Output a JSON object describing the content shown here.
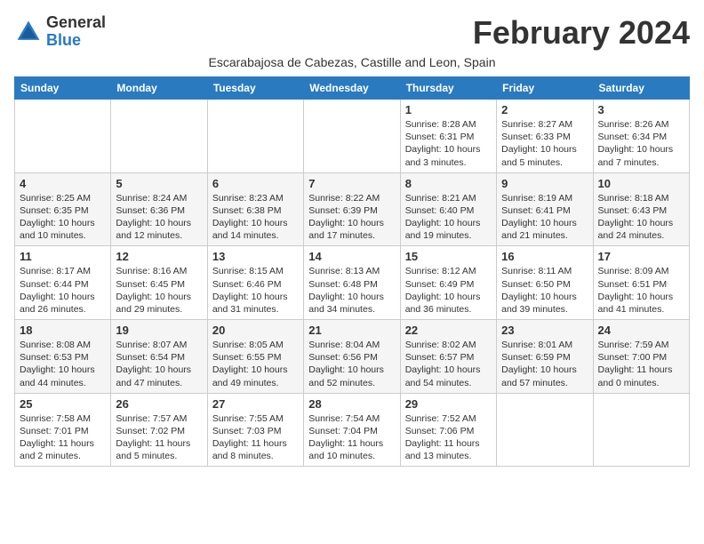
{
  "logo": {
    "general": "General",
    "blue": "Blue"
  },
  "title": "February 2024",
  "subtitle": "Escarabajosa de Cabezas, Castille and Leon, Spain",
  "days_of_week": [
    "Sunday",
    "Monday",
    "Tuesday",
    "Wednesday",
    "Thursday",
    "Friday",
    "Saturday"
  ],
  "weeks": [
    [
      {
        "day": "",
        "info": ""
      },
      {
        "day": "",
        "info": ""
      },
      {
        "day": "",
        "info": ""
      },
      {
        "day": "",
        "info": ""
      },
      {
        "day": "1",
        "info": "Sunrise: 8:28 AM\nSunset: 6:31 PM\nDaylight: 10 hours\nand 3 minutes."
      },
      {
        "day": "2",
        "info": "Sunrise: 8:27 AM\nSunset: 6:33 PM\nDaylight: 10 hours\nand 5 minutes."
      },
      {
        "day": "3",
        "info": "Sunrise: 8:26 AM\nSunset: 6:34 PM\nDaylight: 10 hours\nand 7 minutes."
      }
    ],
    [
      {
        "day": "4",
        "info": "Sunrise: 8:25 AM\nSunset: 6:35 PM\nDaylight: 10 hours\nand 10 minutes."
      },
      {
        "day": "5",
        "info": "Sunrise: 8:24 AM\nSunset: 6:36 PM\nDaylight: 10 hours\nand 12 minutes."
      },
      {
        "day": "6",
        "info": "Sunrise: 8:23 AM\nSunset: 6:38 PM\nDaylight: 10 hours\nand 14 minutes."
      },
      {
        "day": "7",
        "info": "Sunrise: 8:22 AM\nSunset: 6:39 PM\nDaylight: 10 hours\nand 17 minutes."
      },
      {
        "day": "8",
        "info": "Sunrise: 8:21 AM\nSunset: 6:40 PM\nDaylight: 10 hours\nand 19 minutes."
      },
      {
        "day": "9",
        "info": "Sunrise: 8:19 AM\nSunset: 6:41 PM\nDaylight: 10 hours\nand 21 minutes."
      },
      {
        "day": "10",
        "info": "Sunrise: 8:18 AM\nSunset: 6:43 PM\nDaylight: 10 hours\nand 24 minutes."
      }
    ],
    [
      {
        "day": "11",
        "info": "Sunrise: 8:17 AM\nSunset: 6:44 PM\nDaylight: 10 hours\nand 26 minutes."
      },
      {
        "day": "12",
        "info": "Sunrise: 8:16 AM\nSunset: 6:45 PM\nDaylight: 10 hours\nand 29 minutes."
      },
      {
        "day": "13",
        "info": "Sunrise: 8:15 AM\nSunset: 6:46 PM\nDaylight: 10 hours\nand 31 minutes."
      },
      {
        "day": "14",
        "info": "Sunrise: 8:13 AM\nSunset: 6:48 PM\nDaylight: 10 hours\nand 34 minutes."
      },
      {
        "day": "15",
        "info": "Sunrise: 8:12 AM\nSunset: 6:49 PM\nDaylight: 10 hours\nand 36 minutes."
      },
      {
        "day": "16",
        "info": "Sunrise: 8:11 AM\nSunset: 6:50 PM\nDaylight: 10 hours\nand 39 minutes."
      },
      {
        "day": "17",
        "info": "Sunrise: 8:09 AM\nSunset: 6:51 PM\nDaylight: 10 hours\nand 41 minutes."
      }
    ],
    [
      {
        "day": "18",
        "info": "Sunrise: 8:08 AM\nSunset: 6:53 PM\nDaylight: 10 hours\nand 44 minutes."
      },
      {
        "day": "19",
        "info": "Sunrise: 8:07 AM\nSunset: 6:54 PM\nDaylight: 10 hours\nand 47 minutes."
      },
      {
        "day": "20",
        "info": "Sunrise: 8:05 AM\nSunset: 6:55 PM\nDaylight: 10 hours\nand 49 minutes."
      },
      {
        "day": "21",
        "info": "Sunrise: 8:04 AM\nSunset: 6:56 PM\nDaylight: 10 hours\nand 52 minutes."
      },
      {
        "day": "22",
        "info": "Sunrise: 8:02 AM\nSunset: 6:57 PM\nDaylight: 10 hours\nand 54 minutes."
      },
      {
        "day": "23",
        "info": "Sunrise: 8:01 AM\nSunset: 6:59 PM\nDaylight: 10 hours\nand 57 minutes."
      },
      {
        "day": "24",
        "info": "Sunrise: 7:59 AM\nSunset: 7:00 PM\nDaylight: 11 hours\nand 0 minutes."
      }
    ],
    [
      {
        "day": "25",
        "info": "Sunrise: 7:58 AM\nSunset: 7:01 PM\nDaylight: 11 hours\nand 2 minutes."
      },
      {
        "day": "26",
        "info": "Sunrise: 7:57 AM\nSunset: 7:02 PM\nDaylight: 11 hours\nand 5 minutes."
      },
      {
        "day": "27",
        "info": "Sunrise: 7:55 AM\nSunset: 7:03 PM\nDaylight: 11 hours\nand 8 minutes."
      },
      {
        "day": "28",
        "info": "Sunrise: 7:54 AM\nSunset: 7:04 PM\nDaylight: 11 hours\nand 10 minutes."
      },
      {
        "day": "29",
        "info": "Sunrise: 7:52 AM\nSunset: 7:06 PM\nDaylight: 11 hours\nand 13 minutes."
      },
      {
        "day": "",
        "info": ""
      },
      {
        "day": "",
        "info": ""
      }
    ]
  ]
}
